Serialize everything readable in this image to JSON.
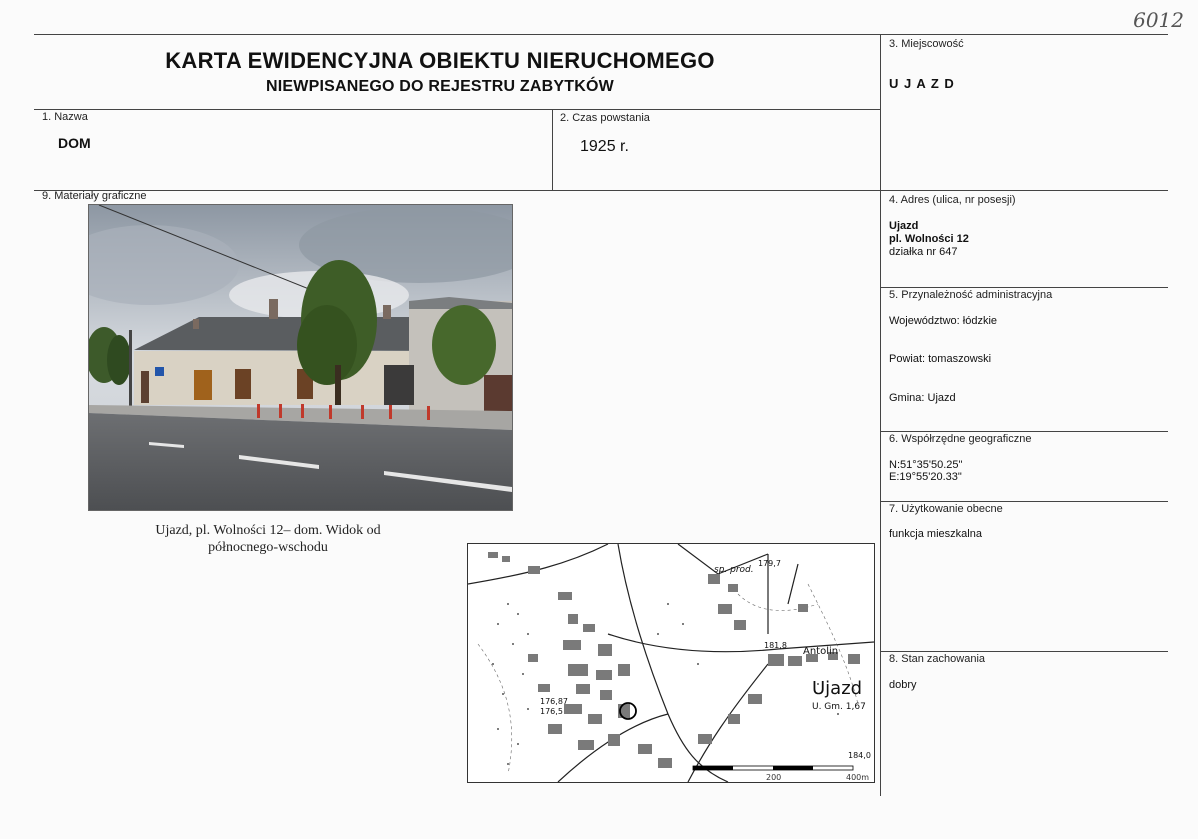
{
  "doc": {
    "title": "KARTA EWIDENCYJNA OBIEKTU NIERUCHOMEGO",
    "subtitle": "NIEWPISANEGO DO REJESTRU ZABYTKÓW",
    "page_mark": "6012"
  },
  "fields": {
    "nazwa": {
      "label": "1. Nazwa",
      "value": "DOM"
    },
    "czas": {
      "label": "2. Czas powstania",
      "value": "1925 r."
    },
    "miejscowosc": {
      "label": "3. Miejscowość",
      "value": "U J A Z D"
    },
    "adres": {
      "label": "4. Adres (ulica, nr posesji)",
      "line1": "Ujazd",
      "line2": "pl. Wolności 12",
      "line3": "działka nr 647"
    },
    "przynaleznosc": {
      "label": "5. Przynależność administracyjna",
      "wojewodztwo": "Województwo: łódzkie",
      "powiat": "Powiat: tomaszowski",
      "gmina": "Gmina: Ujazd"
    },
    "wspolrzedne": {
      "label": "6. Współrzędne geograficzne",
      "n": "N:51°35'50.25\"",
      "e": "E:19°55'20.33\""
    },
    "uzytkowanie": {
      "label": "7. Użytkowanie obecne",
      "value": "funkcja mieszkalna"
    },
    "stan": {
      "label": "8. Stan zachowania",
      "value": "dobry"
    },
    "materialy": {
      "label": "9. Materiały graficzne"
    }
  },
  "caption": {
    "line1": "Ujazd, pl. Wolności 12– dom. Widok od",
    "line2": "północnego-wschodu"
  },
  "map": {
    "labels": {
      "town": "Ujazd",
      "gmina": "U. Gm. 1,67",
      "antolin": "Antolin",
      "sp_prod": "sp. prod.",
      "elev1": "179,7",
      "elev2": "181,8",
      "elev3": "176,87",
      "elev4": "176,5",
      "elev5": "184,0",
      "scale_a": "200",
      "scale_b": "400m"
    }
  }
}
